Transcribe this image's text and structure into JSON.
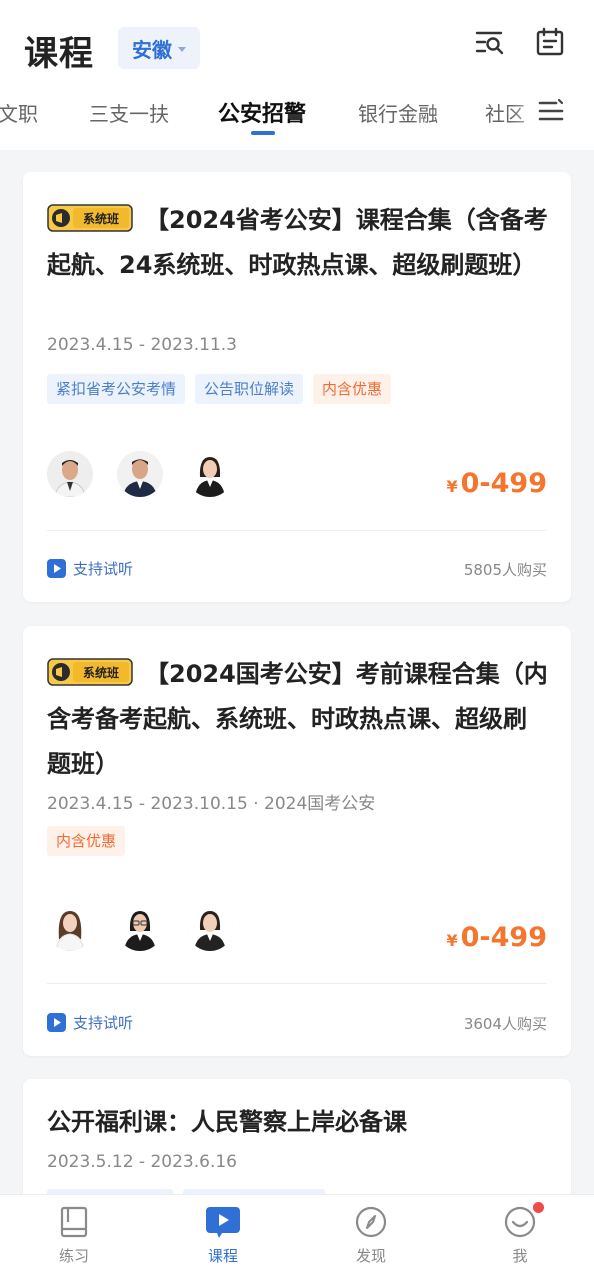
{
  "header": {
    "title": "课程",
    "region": "安徽",
    "icons": [
      "filter-search-icon",
      "calendar-icon",
      "menu-lines-icon"
    ]
  },
  "tabs": [
    {
      "label": "文职",
      "active": false
    },
    {
      "label": "三支一扶",
      "active": false
    },
    {
      "label": "公安招警",
      "active": true
    },
    {
      "label": "银行金融",
      "active": false
    },
    {
      "label": "社区",
      "active": false
    }
  ],
  "courses": [
    {
      "badge": "系统班",
      "title": "【2024省考公安】课程合集（含备考起航、24系统班、时政热点课、超级刷题班）",
      "date": "2023.4.15 - 2023.11.3",
      "tags": [
        {
          "label": "紧扣省考公安考情",
          "color": "blue"
        },
        {
          "label": "公告职位解读",
          "color": "blue"
        },
        {
          "label": "内含优惠",
          "color": "orange"
        }
      ],
      "price_symbol": "¥",
      "price": "0-499",
      "trial": "支持试听",
      "buyers": "5805人购买"
    },
    {
      "badge": "系统班",
      "title": "【2024国考公安】考前课程合集（内含考备考起航、系统班、时政热点课、超级刷题班）",
      "date": "2023.4.15 - 2023.10.15 · 2024国考公安",
      "tags": [
        {
          "label": "内含优惠",
          "color": "orange"
        }
      ],
      "price_symbol": "¥",
      "price": "0-499",
      "trial": "支持试听",
      "buyers": "3604人购买"
    },
    {
      "title": "公开福利课：人民警察上岸必备课",
      "date": "2023.5.12 - 2023.6.16"
    }
  ],
  "tabbar": [
    {
      "label": "练习",
      "icon": "book-icon",
      "active": false
    },
    {
      "label": "课程",
      "icon": "play-video-icon",
      "active": true
    },
    {
      "label": "发现",
      "icon": "compass-icon",
      "active": false
    },
    {
      "label": "我",
      "icon": "smiley-profile-icon",
      "active": false,
      "notification_dot": true
    }
  ],
  "colors": {
    "accent": "#2f6fd6",
    "price": "#f5742e",
    "background": "#f4f5f7"
  }
}
